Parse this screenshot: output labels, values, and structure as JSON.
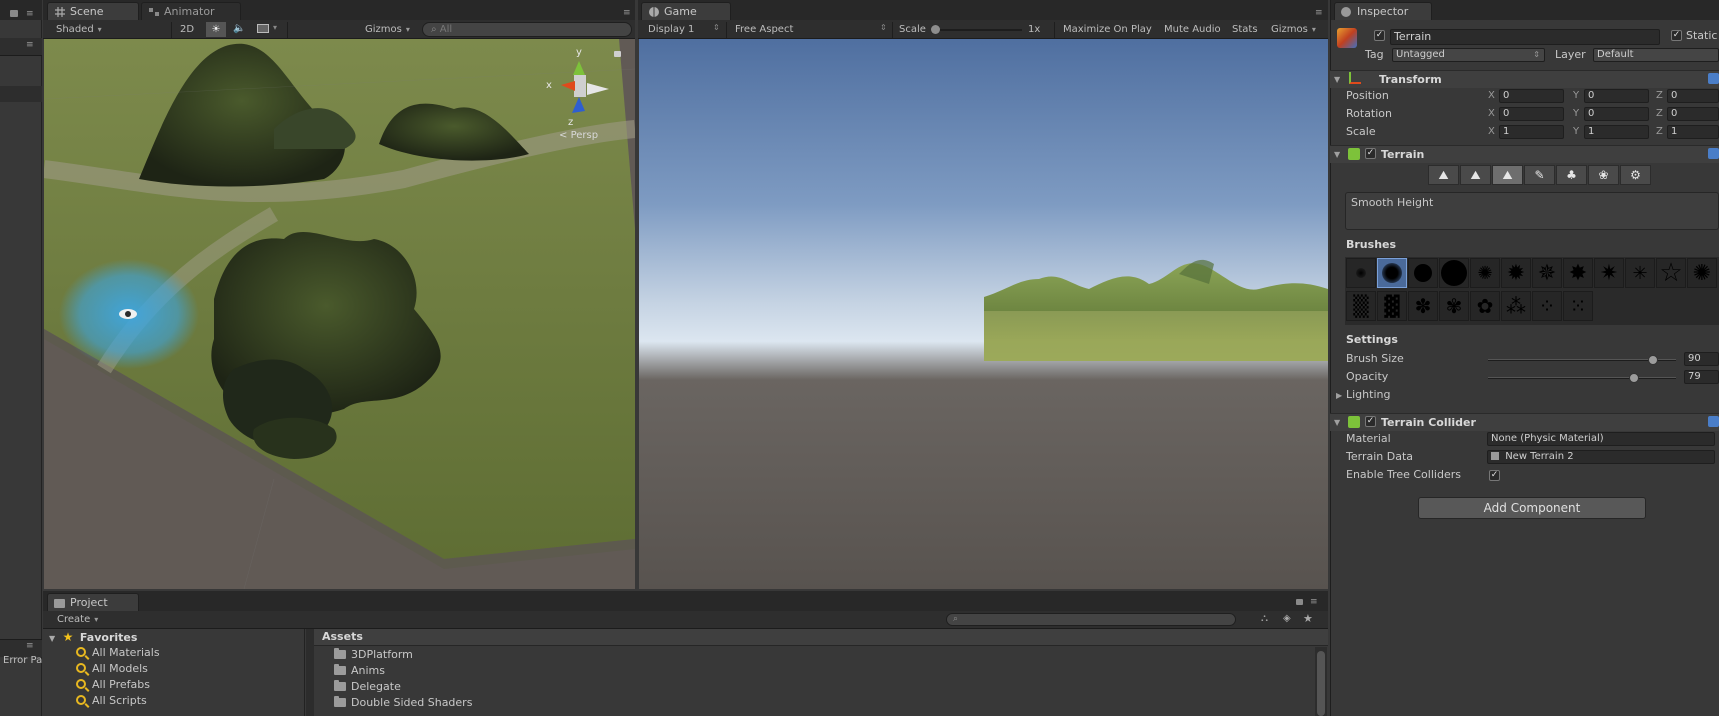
{
  "left_strip": {
    "label": "Error Pa"
  },
  "scene": {
    "tab_scene": "Scene",
    "tab_animator": "Animator",
    "shading": "Shaded",
    "mode_2d": "2D",
    "gizmos": "Gizmos",
    "search_placeholder": "All",
    "gizmo_y": "y",
    "gizmo_x": "x",
    "gizmo_z": "z",
    "persp": "Persp"
  },
  "game": {
    "tab": "Game",
    "display": "Display 1",
    "aspect": "Free Aspect",
    "scale_label": "Scale",
    "scale_value": "1x",
    "maximize": "Maximize On Play",
    "mute": "Mute Audio",
    "stats": "Stats",
    "gizmos": "Gizmos"
  },
  "inspector": {
    "tab": "Inspector",
    "object_name": "Terrain",
    "static_label": "Static",
    "tag_label": "Tag",
    "tag_value": "Untagged",
    "layer_label": "Layer",
    "layer_value": "Default",
    "transform": {
      "title": "Transform",
      "position_label": "Position",
      "position": {
        "x": "0",
        "y": "0",
        "z": "0"
      },
      "rotation_label": "Rotation",
      "rotation": {
        "x": "0",
        "y": "0",
        "z": "0"
      },
      "scale_label": "Scale",
      "scale": {
        "x": "1",
        "y": "1",
        "z": "1"
      }
    },
    "terrain": {
      "title": "Terrain",
      "tool_description": "Smooth Height",
      "brushes_label": "Brushes",
      "settings_label": "Settings",
      "brush_size_label": "Brush Size",
      "brush_size_value": "90",
      "brush_size_fraction": 0.9,
      "opacity_label": "Opacity",
      "opacity_value": "79",
      "opacity_fraction": 0.79,
      "lighting_label": "Lighting"
    },
    "collider": {
      "title": "Terrain Collider",
      "material_label": "Material",
      "material_value": "None (Physic Material)",
      "data_label": "Terrain Data",
      "data_value": "New Terrain 2",
      "trees_label": "Enable Tree Colliders"
    },
    "add_component": "Add Component"
  },
  "project": {
    "tab": "Project",
    "create": "Create",
    "favorites_label": "Favorites",
    "favorites": [
      "All Materials",
      "All Models",
      "All Prefabs",
      "All Scripts"
    ],
    "assets_label": "Assets",
    "assets": [
      "3DPlatform",
      "Anims",
      "Delegate",
      "Double Sided Shaders"
    ]
  },
  "colors": {
    "sky_top": "#4f6fa0",
    "sky_horizon": "#dce6f0",
    "ground": "#58534f",
    "brush_preview": "#3ea6e0"
  }
}
